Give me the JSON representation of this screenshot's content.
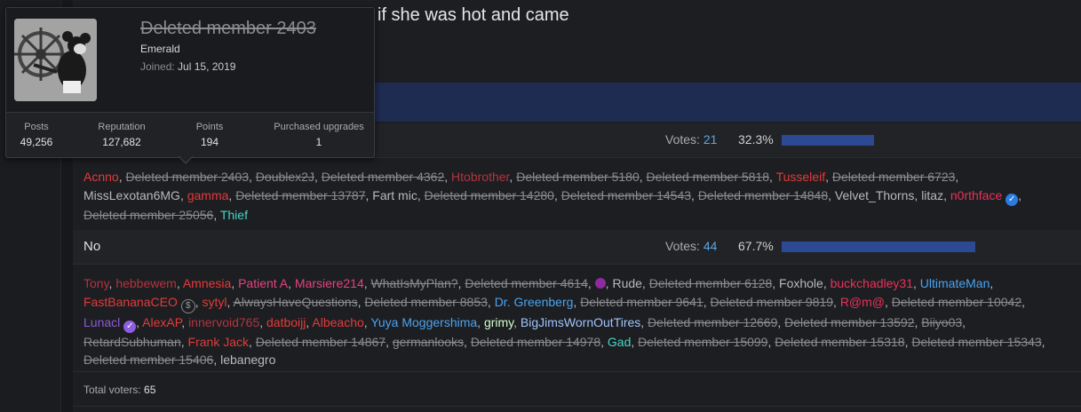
{
  "thread": {
    "header_visible": "if she was hot and came"
  },
  "tooltip": {
    "username": "Deleted member 2403",
    "user_title": "Emerald",
    "joined_label": "Joined:",
    "joined_date": "Jul 15, 2019",
    "stats": [
      {
        "label": "Posts",
        "value": "49,256"
      },
      {
        "label": "Reputation",
        "value": "127,682"
      },
      {
        "label": "Points",
        "value": "194"
      },
      {
        "label": "Purchased upgrades",
        "value": "1"
      }
    ]
  },
  "poll": {
    "votes_label": "Votes:",
    "options": [
      {
        "label": "",
        "votes": "21",
        "percent": "32.3%",
        "fill": 0.323
      },
      {
        "label": "No",
        "votes": "44",
        "percent": "67.7%",
        "fill": 0.677
      }
    ],
    "yes_voters": [
      {
        "n": "Acnno",
        "c": "red"
      },
      {
        "n": "Deleted member 2403",
        "c": "del"
      },
      {
        "n": "Doublex2J",
        "c": "del"
      },
      {
        "n": "Deleted member 4362",
        "c": "del"
      },
      {
        "n": "Htobrother",
        "c": "maroon"
      },
      {
        "n": "Deleted member 5180",
        "c": "del"
      },
      {
        "n": "Deleted member 5818",
        "c": "del"
      },
      {
        "n": "Tusseleif",
        "c": "red"
      },
      {
        "n": "Deleted member 6723",
        "c": "del"
      },
      {
        "n": "MissLexotan6MG",
        "c": ""
      },
      {
        "n": "gamma",
        "c": "red"
      },
      {
        "n": "Deleted member 13787",
        "c": "del"
      },
      {
        "n": "Fart mic",
        "c": ""
      },
      {
        "n": "Deleted member 14280",
        "c": "del"
      },
      {
        "n": "Deleted member 14543",
        "c": "del"
      },
      {
        "n": "Deleted member 14848",
        "c": "del"
      },
      {
        "n": "Velvet_Thorns",
        "c": ""
      },
      {
        "n": "litaz",
        "c": ""
      },
      {
        "n": "n0rthface",
        "c": "crimson",
        "badge": "blue"
      },
      {
        "n": "Deleted member 25056",
        "c": "del"
      },
      {
        "n": "Thief",
        "c": "teal"
      }
    ],
    "no_voters": [
      {
        "n": "Tony",
        "c": "maroon"
      },
      {
        "n": "hebbewem",
        "c": "maroon"
      },
      {
        "n": "Amnesia",
        "c": "red"
      },
      {
        "n": "Patient A",
        "c": "pink"
      },
      {
        "n": "Marsiere214",
        "c": "pink"
      },
      {
        "n": "WhatIsMyPlan?",
        "c": "del"
      },
      {
        "n": "Deleted member 4614",
        "c": "del"
      },
      {
        "n": "",
        "c": "",
        "dot": true
      },
      {
        "n": "Rude",
        "c": ""
      },
      {
        "n": "Deleted member 6128",
        "c": "del"
      },
      {
        "n": "Foxhole",
        "c": ""
      },
      {
        "n": "buckchadley31",
        "c": "crimson"
      },
      {
        "n": "UltimateMan",
        "c": "blue"
      },
      {
        "n": "FastBananaCEO",
        "c": "red",
        "dollar": true
      },
      {
        "n": "sytyl",
        "c": "red"
      },
      {
        "n": "AlwaysHaveQuestions",
        "c": "del"
      },
      {
        "n": "Deleted member 8853",
        "c": "del"
      },
      {
        "n": "Dr. Greenberg",
        "c": "blue"
      },
      {
        "n": "Deleted member 9641",
        "c": "del"
      },
      {
        "n": "Deleted member 9819",
        "c": "del"
      },
      {
        "n": "R@m@",
        "c": "crimson"
      },
      {
        "n": "Deleted member 10042",
        "c": "del"
      },
      {
        "n": "Lunacl",
        "c": "purple",
        "badge": "purple"
      },
      {
        "n": "AlexAP",
        "c": "red"
      },
      {
        "n": "innervoid765",
        "c": "maroon"
      },
      {
        "n": "datboijj",
        "c": "red"
      },
      {
        "n": "Albeacho",
        "c": "red"
      },
      {
        "n": "Yuya Moggershima",
        "c": "blue"
      },
      {
        "n": "grimy",
        "c": "green"
      },
      {
        "n": "BigJimsWornOutTires",
        "c": "sky"
      },
      {
        "n": "Deleted member 12669",
        "c": "del"
      },
      {
        "n": "Deleted member 13592",
        "c": "del"
      },
      {
        "n": "Biiyo03",
        "c": "del"
      },
      {
        "n": "RetardSubhuman",
        "c": "del"
      },
      {
        "n": "Frank Jack",
        "c": "red"
      },
      {
        "n": "Deleted member 14867",
        "c": "del"
      },
      {
        "n": "germanlooks",
        "c": "del"
      },
      {
        "n": "Deleted member 14978",
        "c": "del"
      },
      {
        "n": "Gad",
        "c": "teal"
      },
      {
        "n": "Deleted member 15099",
        "c": "del"
      },
      {
        "n": "Deleted member 15318",
        "c": "del"
      },
      {
        "n": "Deleted member 15343",
        "c": "del"
      },
      {
        "n": "Deleted member 15406",
        "c": "del"
      },
      {
        "n": "lebanegro",
        "c": ""
      }
    ],
    "total_label": "Total voters:",
    "total_value": "65"
  },
  "colors": {
    "bar": "#2b4a93",
    "accent_blue": "#1e2c52"
  }
}
